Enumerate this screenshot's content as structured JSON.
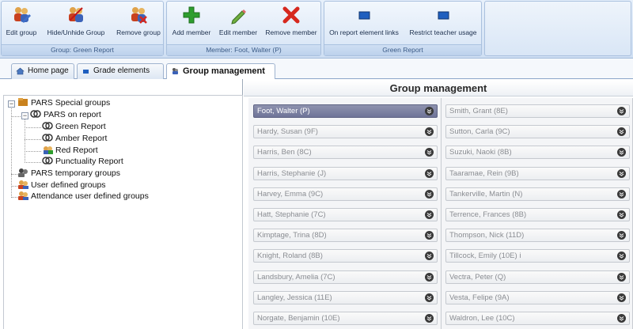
{
  "ribbon": {
    "groups": [
      {
        "caption": "Group: Green Report",
        "buttons": [
          {
            "label": "Edit group",
            "icon": "edit-group-icon"
          },
          {
            "label": "Hide/Unhide Group",
            "icon": "hide-group-icon"
          },
          {
            "label": "Remove group",
            "icon": "remove-group-icon"
          }
        ]
      },
      {
        "caption": "Member: Foot, Walter (P)",
        "buttons": [
          {
            "label": "Add member",
            "icon": "plus-icon"
          },
          {
            "label": "Edit member",
            "icon": "pencil-icon"
          },
          {
            "label": "Remove member",
            "icon": "red-x-icon"
          }
        ]
      },
      {
        "caption": "Green Report",
        "buttons": [
          {
            "label": "On report element links",
            "icon": "blue-square-icon"
          },
          {
            "label": "Restrict teacher usage",
            "icon": "blue-square-icon"
          }
        ]
      }
    ]
  },
  "tabs": [
    {
      "label": "Home page",
      "icon": "home-icon"
    },
    {
      "label": "Grade elements",
      "icon": "grade-icon"
    },
    {
      "label": "Group management",
      "icon": "group-mgmt-icon",
      "active": true
    }
  ],
  "tree": {
    "items": [
      {
        "label": "PARS Special groups",
        "expanded": true
      },
      {
        "label": "PARS on report",
        "expanded": true
      },
      {
        "label": "Green Report"
      },
      {
        "label": "Amber Report"
      },
      {
        "label": "Red Report"
      },
      {
        "label": "Punctuality Report"
      },
      {
        "label": "PARS temporary groups"
      },
      {
        "label": "User defined groups"
      },
      {
        "label": "Attendance user defined groups"
      }
    ]
  },
  "main": {
    "title": "Group management",
    "members_left": [
      "Foot, Walter (P)",
      "Hardy, Susan (9F)",
      "Harris, Ben (8C)",
      "Harris, Stephanie (J)",
      "Harvey, Emma (9C)",
      "Hatt, Stephanie (7C)",
      "Kimptage, Trina (8D)",
      "Knight, Roland (8B)",
      "Landsbury, Amelia (7C)",
      "Langley, Jessica (11E)",
      "Norgate, Benjamin (10E)"
    ],
    "members_right": [
      "Smith, Grant (8E)",
      "Sutton, Carla (9C)",
      "Suzuki, Naoki (8B)",
      "Taaramae, Rein (9B)",
      "Tankerville, Martin (N)",
      "Terrence, Frances (8B)",
      "Thompson, Nick (11D)",
      "Tillcock, Emily (10E)   i",
      "Vectra, Peter (Q)",
      "Vesta, Felipe (9A)",
      "Waldron, Lee (10C)"
    ],
    "selected_member": "Foot, Walter (P)"
  },
  "colors": {
    "ribbon_bg": "#d6e4f5",
    "selected_member": "#7f84a4",
    "add_green": "#2e9e2e",
    "remove_red": "#d6281e",
    "blue_square": "#1f5fbf"
  }
}
